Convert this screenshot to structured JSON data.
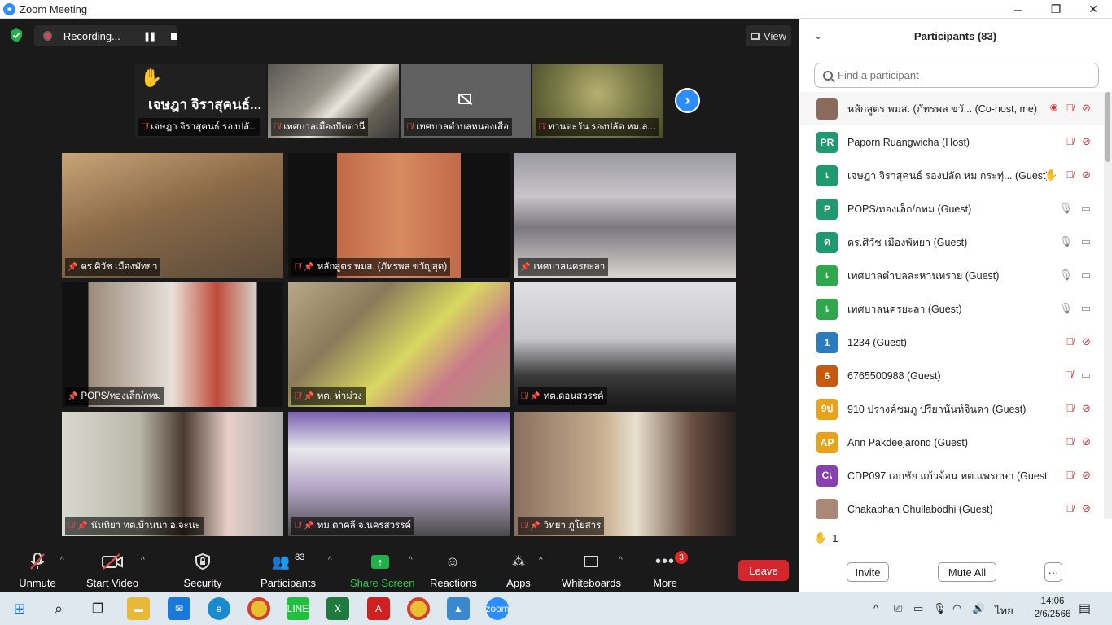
{
  "window": {
    "title": "Zoom Meeting",
    "minimize": "─",
    "restore": "❐",
    "close": "✕"
  },
  "recording": {
    "label": "Recording...",
    "pause": "❚❚"
  },
  "view_label": "View",
  "strip": [
    {
      "name": "เจษฎา จิราสุคนธ์ รองปลั...",
      "big_name": "เจษฎา จิราสุคนธ์...",
      "hand": "✋"
    },
    {
      "name": "เทศบาลเมืองปัตตานี"
    },
    {
      "name": "เทศบาลตำบลหนองเสือ"
    },
    {
      "name": "ทานตะวัน  รองปลัด หม.ล..."
    }
  ],
  "tiles": [
    {
      "name": "ดร.ศิวัช เมืองพัทยา",
      "muted": false
    },
    {
      "name": "หลักสูตร พมส. (ภัทรพล ขวัญสุด)",
      "muted": true
    },
    {
      "name": "เทศบาลนครยะลา",
      "muted": false
    },
    {
      "name": "POPS/ทองเล็ก/กทม",
      "muted": false
    },
    {
      "name": "ทต. ท่าม่วง",
      "muted": true
    },
    {
      "name": "ทต.ดอนสวรรค์",
      "muted": true
    },
    {
      "name": "นันทิยา ทต.บ้านนา อ.จะนะ",
      "muted": true
    },
    {
      "name": "ทม.ตาคลี จ.นครสวรรค์",
      "muted": true
    },
    {
      "name": "วิทยา ภูโยสาร",
      "muted": true
    }
  ],
  "toolbar": {
    "unmute": "Unmute",
    "start_video": "Start Video",
    "security": "Security",
    "participants": "Participants",
    "participants_count": "83",
    "share_screen": "Share Screen",
    "reactions": "Reactions",
    "apps": "Apps",
    "whiteboards": "Whiteboards",
    "more": "More",
    "more_badge": "3",
    "leave": "Leave"
  },
  "panel": {
    "title": "Participants (83)",
    "search_placeholder": "Find a participant",
    "raised_count": "1",
    "invite": "Invite",
    "mute_all": "Mute All",
    "more_dots": "···",
    "participants": [
      {
        "initials": "",
        "color": "#8a6a5a",
        "name": "หลักสูตร พมส. (ภัทรพล ขวั...  (Co-host, me)",
        "mic": "off",
        "cam": "off",
        "rec": true
      },
      {
        "initials": "PR",
        "color": "#1f9a6e",
        "name": "Paporn Ruangwicha (Host)",
        "mic": "off",
        "cam": "off"
      },
      {
        "initials": "เ",
        "color": "#1f9a6e",
        "name": "เจษฎา จิราสุคนธ์ รองปลัด หม กระทุ่... (Guest)",
        "mic": "off",
        "cam": "off",
        "hand": true
      },
      {
        "initials": "P",
        "color": "#1f9a6e",
        "name": "POPS/ทองเล็ก/กทม (Guest)",
        "mic": "on",
        "cam": "on"
      },
      {
        "initials": "ด",
        "color": "#1f9a6e",
        "name": "ดร.ศิวัช เมืองพัทยา (Guest)",
        "mic": "on",
        "cam": "on"
      },
      {
        "initials": "เ",
        "color": "#2ea84a",
        "name": "เทศบาลตำบลละหานทราย (Guest)",
        "mic": "on",
        "cam": "on"
      },
      {
        "initials": "เ",
        "color": "#2ea84a",
        "name": "เทศบาลนครยะลา (Guest)",
        "mic": "on",
        "cam": "on"
      },
      {
        "initials": "1",
        "color": "#2a7bbf",
        "name": "1234 (Guest)",
        "mic": "off",
        "cam": "off"
      },
      {
        "initials": "6",
        "color": "#c85a10",
        "name": "6765500988 (Guest)",
        "mic": "off",
        "cam": "on"
      },
      {
        "initials": "9ป",
        "color": "#e8a318",
        "name": "910 ปรางค์ชมภู ปรียานันท์จินดา (Guest)",
        "mic": "off",
        "cam": "off"
      },
      {
        "initials": "AP",
        "color": "#e8a318",
        "name": "Ann Pakdeejarond (Guest)",
        "mic": "off",
        "cam": "off"
      },
      {
        "initials": "Cเ",
        "color": "#8a3fb0",
        "name": "CDP097 เอกชัย แก้วจ้อน ทต.แพรกษา (Guest)",
        "mic": "off",
        "cam": "off"
      },
      {
        "initials": "",
        "color": "#aa8877",
        "name": "Chakaphan Chullabodhi (Guest)",
        "mic": "off",
        "cam": "off"
      }
    ]
  },
  "taskbar": {
    "time": "14:06",
    "date": "2/6/2566",
    "lang": "ไทย"
  }
}
